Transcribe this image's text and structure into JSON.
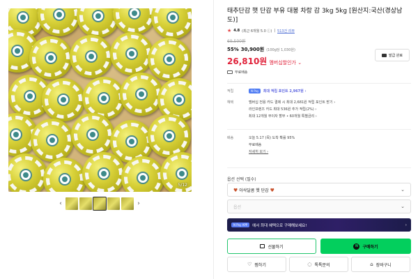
{
  "product": {
    "title": "태추단감 햇 단감 부유 대봉 차랑 감 3kg 5kg [원산지:국산(경상남도)]",
    "rating": {
      "score": "4.8",
      "detail": "(최근 6개월 5.0 ⓘ)",
      "reviews": "513건 리뷰"
    },
    "price_original": "69,500원",
    "discount": "55%",
    "price": "30,900원",
    "unit_price": "(100g당 1,030원)",
    "member_price": "26,810원",
    "member_label": "멤버십할인가 ⌄",
    "shipping_short": "무료배송",
    "image_counter": "5/12",
    "coupon_button": "발급 완료"
  },
  "benefits": {
    "point": {
      "label": "적립",
      "badge": "N Pay",
      "text": "최대 적립 포인트 2,967원 ›"
    },
    "discount": {
      "label": "혜택",
      "lines": [
        "멤버십 전용 카드 결제 시 최대 2,681원 적립 포인트 받기 ›",
        "라인프렌즈 카드 최대 536원 추가 적립(2%) ›",
        "최대 12개월 무이자 할부 • 60개월 특별금리 ›"
      ]
    },
    "delivery": {
      "label": "배송",
      "lines": [
        "오늘 5.17 (목) 도착 확률 95%",
        "무료배송"
      ],
      "link": "자세히 보기 ›"
    }
  },
  "options": {
    "label": "옵션 선택 (필수)",
    "selected": "아삭달콤 햇 단감",
    "second_placeholder": "옵션"
  },
  "banner": {
    "badge": "N Pay APP",
    "text": "에서 최대 혜택으로 구매해보세요!"
  },
  "buttons": {
    "gift": "선물하기",
    "buy": "구매하기",
    "wish": "찜하기",
    "talk": "톡톡문의",
    "cart": "장바구니"
  },
  "colors": {
    "member_price": "#e0223a",
    "buy_button": "#03cf5d",
    "banner_bg": "#1c1c4a"
  }
}
